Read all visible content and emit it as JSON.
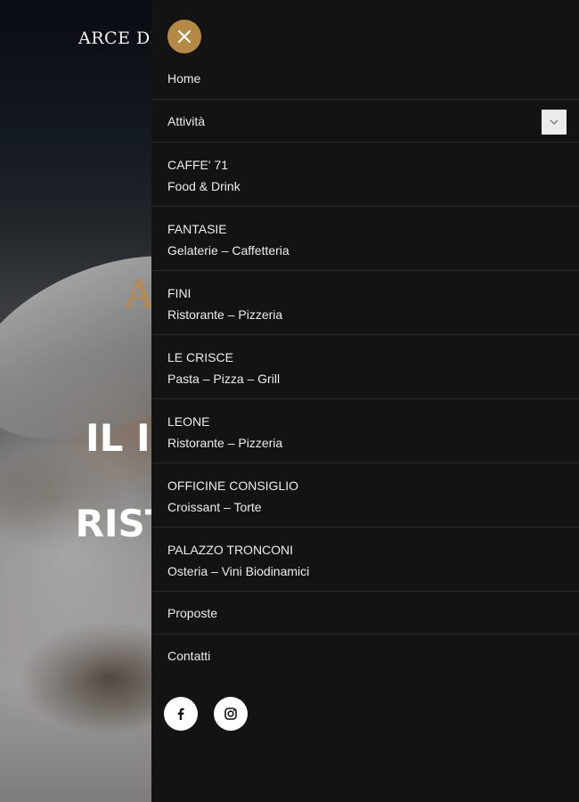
{
  "hero": {
    "logo": "ARCE DI",
    "accent": "A",
    "title_line1": "IL I",
    "title_line2": "RISTO"
  },
  "menu": {
    "close_icon": "close-icon",
    "accent_color": "#b48943",
    "items": [
      {
        "label": "Home"
      },
      {
        "label": "Attività",
        "has_toggle": true,
        "toggle_icon": "chevron-down-icon"
      }
    ],
    "venues": [
      {
        "name": "CAFFE' 71",
        "desc": "Food & Drink"
      },
      {
        "name": "FANTASIE",
        "desc": "Gelaterie – Caffetteria"
      },
      {
        "name": "FINI",
        "desc": "Ristorante – Pizzeria"
      },
      {
        "name": "LE CRISCE",
        "desc": "Pasta – Pizza – Grill"
      },
      {
        "name": "LEONE",
        "desc": "Ristorante – Pizzeria"
      },
      {
        "name": "OFFICINE CONSIGLIO",
        "desc": "Croissant – Torte"
      },
      {
        "name": "PALAZZO TRONCONI",
        "desc": "Osteria – Vini Biodinamici"
      }
    ],
    "bottom_items": [
      {
        "label": "Proposte"
      },
      {
        "label": "Contatti"
      }
    ],
    "socials": [
      "facebook-icon",
      "instagram-icon"
    ]
  }
}
